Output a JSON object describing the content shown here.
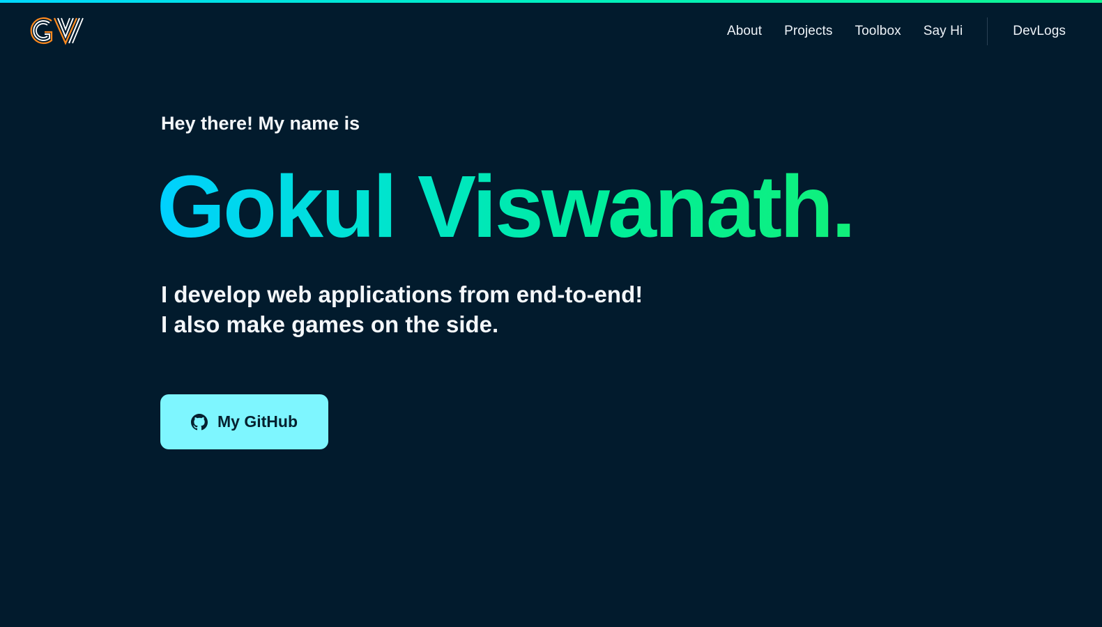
{
  "page": {
    "background_color": "#021b2d",
    "accent_gradient": [
      "#00d0ff",
      "#11f07a"
    ]
  },
  "header": {
    "logo_text": "GV",
    "nav": {
      "about": "About",
      "projects": "Projects",
      "toolbox": "Toolbox",
      "say_hi": "Say Hi",
      "devlogs": "DevLogs"
    }
  },
  "hero": {
    "greeting": "Hey there! My name is",
    "name": "Gokul Viswanath.",
    "tagline_line1": "I develop web applications from end-to-end!",
    "tagline_line2": "I also make games on the side.",
    "github_button": {
      "label": "My GitHub",
      "icon": "github-icon",
      "background_color": "#7ef6ff"
    }
  }
}
